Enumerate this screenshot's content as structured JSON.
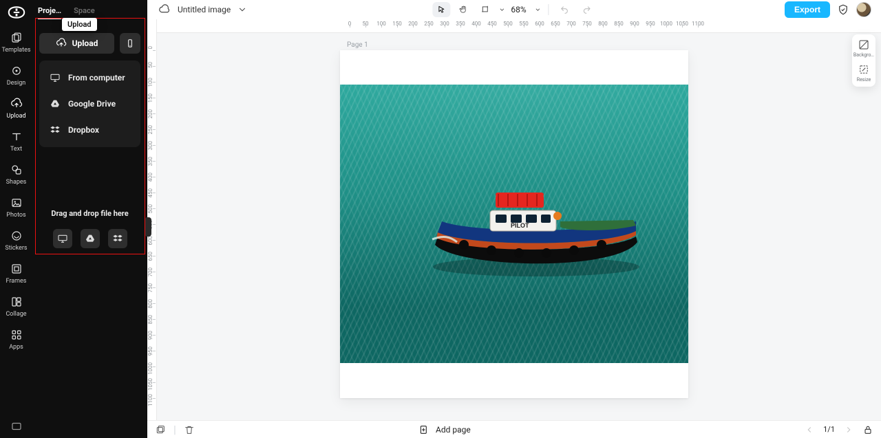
{
  "rail": {
    "templates": "Templates",
    "design": "Design",
    "upload": "Upload",
    "text": "Text",
    "shapes": "Shapes",
    "photos": "Photos",
    "stickers": "Stickers",
    "frames": "Frames",
    "collage": "Collage",
    "apps": "Apps"
  },
  "panel": {
    "tabs": {
      "project": "Proje…",
      "space": "Space"
    },
    "tooltip_upload": "Upload",
    "upload_button": "Upload",
    "sources": {
      "from_computer": "From computer",
      "google_drive": "Google Drive",
      "dropbox": "Dropbox"
    },
    "dragdrop_hint": "Drag and drop file here"
  },
  "topbar": {
    "doc_title": "Untitled image",
    "zoom_label": "68%",
    "export_label": "Export"
  },
  "ruler": {
    "h_labels": [
      "0",
      "50",
      "100",
      "150",
      "200",
      "250",
      "300",
      "350",
      "400",
      "450",
      "500",
      "550",
      "600",
      "650",
      "700",
      "750",
      "800",
      "850",
      "900",
      "950",
      "1000",
      "1050",
      "1100"
    ],
    "v_labels": [
      "0",
      "50",
      "100",
      "150",
      "200",
      "250",
      "300",
      "350",
      "400",
      "450",
      "500",
      "550",
      "600",
      "650",
      "700",
      "750",
      "800",
      "850",
      "900",
      "950",
      "1000",
      "1050",
      "1100"
    ]
  },
  "canvas": {
    "page_label": "Page 1",
    "boat_text": "PILOT"
  },
  "rightdock": {
    "background": "Backgro…",
    "resize": "Resize"
  },
  "status": {
    "add_page": "Add page",
    "page_counter": "1/1"
  }
}
